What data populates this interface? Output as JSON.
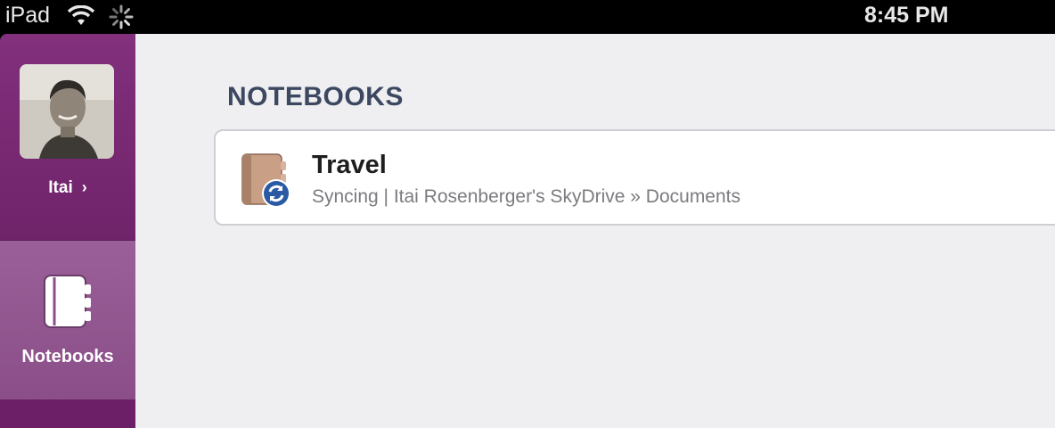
{
  "status_bar": {
    "device": "iPad",
    "time": "8:45 PM",
    "wifi_icon": "wifi-icon",
    "activity_icon": "activity-spinner-icon"
  },
  "sidebar": {
    "accent_color": "#7a2a74",
    "profile": {
      "name": "Itai",
      "chevron": "›",
      "avatar_icon": "avatar"
    },
    "nav_items": [
      {
        "label": "Notebooks",
        "icon": "notebook-icon",
        "selected": true
      }
    ]
  },
  "main": {
    "section_title": "NOTEBOOKS",
    "notebooks": [
      {
        "title": "Travel",
        "status": "Syncing",
        "location": "Itai Rosenberger's SkyDrive » Documents",
        "subtitle": "Syncing | Itai Rosenberger's SkyDrive » Documents",
        "icon": "notebook-sync-icon"
      }
    ]
  }
}
